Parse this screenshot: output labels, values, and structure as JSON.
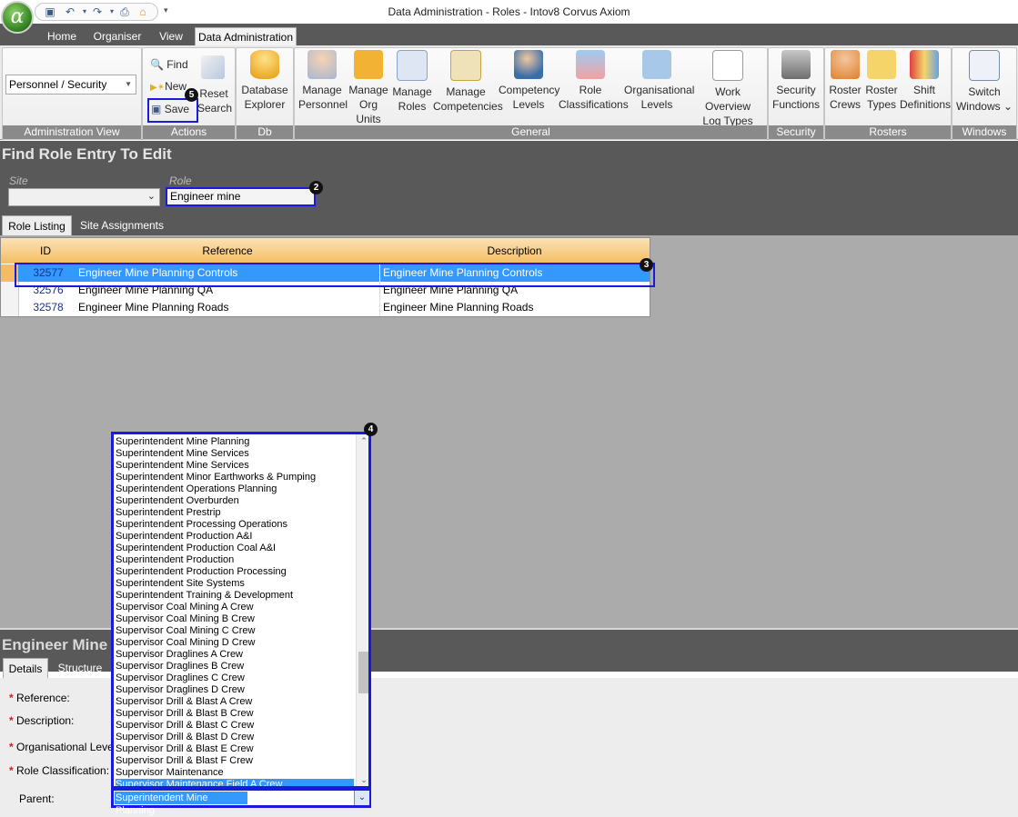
{
  "window": {
    "title": "Data Administration - Roles - Intov8 Corvus Axiom",
    "logo_letter": "α"
  },
  "menu_tabs": [
    "Home",
    "Organiser",
    "View",
    "Data Administration"
  ],
  "ribbon": {
    "admin_view": {
      "selected": "Personnel / Security",
      "caption": "Administration View"
    },
    "actions": {
      "find": "Find",
      "new": "New",
      "save": "Save",
      "reset": "Reset",
      "search": "Search",
      "caption": "Actions"
    },
    "db_explorer": {
      "label_line1": "Database",
      "label_line2": "Explorer",
      "caption": "Db Explorer"
    },
    "general": {
      "caption": "General",
      "buttons": [
        {
          "l1": "Manage",
          "l2": "Personnel",
          "icon": "person-info-icon"
        },
        {
          "l1": "Manage",
          "l2": "Org Units",
          "icon": "org-units-icon"
        },
        {
          "l1": "Manage",
          "l2": "Roles",
          "icon": "roles-card-icon"
        },
        {
          "l1": "Manage",
          "l2": "Competencies",
          "icon": "certificate-icon"
        },
        {
          "l1": "Competency",
          "l2": "Levels",
          "icon": "person-check-icon"
        },
        {
          "l1": "Role",
          "l2": "Classifications",
          "icon": "role-classifications-icon"
        },
        {
          "l1": "Organisational",
          "l2": "Levels",
          "icon": "hierarchy-icon"
        },
        {
          "l1": "Work Overview",
          "l2": "Log Types",
          "icon": "document-icon"
        }
      ]
    },
    "security": {
      "l1": "Security",
      "l2": "Functions",
      "caption": "Security"
    },
    "rosters": {
      "caption": "Rosters",
      "buttons": [
        {
          "l1": "Roster",
          "l2": "Crews"
        },
        {
          "l1": "Roster",
          "l2": "Types"
        },
        {
          "l1": "Shift",
          "l2": "Definitions"
        }
      ]
    },
    "windows": {
      "l1": "Switch",
      "l2": "Windows ⌄",
      "caption": "Windows"
    }
  },
  "find": {
    "title": "Find Role Entry To Edit",
    "site_label": "Site",
    "site_value": "",
    "role_label": "Role",
    "role_value": "Engineer mine"
  },
  "listing_tabs": [
    "Role Listing",
    "Site Assignments"
  ],
  "grid": {
    "headers": [
      "ID",
      "Reference",
      "Description"
    ],
    "rows": [
      {
        "id": "32577",
        "reference": "Engineer Mine Planning Controls",
        "description": "Engineer Mine Planning Controls"
      },
      {
        "id": "32576",
        "reference": "Engineer Mine Planning QA",
        "description": "Engineer Mine Planning QA"
      },
      {
        "id": "32578",
        "reference": "Engineer Mine Planning Roads",
        "description": "Engineer Mine Planning Roads"
      }
    ]
  },
  "detail": {
    "title": "Engineer Mine",
    "tabs": [
      "Details",
      "Structure"
    ],
    "fields": {
      "reference": "Reference:",
      "description": "Description:",
      "org_level": "Organisational Level:",
      "role_classification": "Role Classification:",
      "parent": "Parent:"
    },
    "parent_value": "Superintendent Mine Planning"
  },
  "dropdown": {
    "items": [
      "Superintendent Mine Planning",
      "Superintendent Mine Services",
      "Superintendent Mine Services",
      "Superintendent Minor Earthworks & Pumping",
      "Superintendent Operations Planning",
      "Superintendent Overburden",
      "Superintendent Prestrip",
      "Superintendent Processing Operations",
      "Superintendent Production A&I",
      "Superintendent Production Coal A&I",
      "Superintendent Production",
      "Superintendent Production Processing",
      "Superintendent Site Systems",
      "Superintendent Training & Development",
      "Supervisor Coal Mining A Crew",
      "Supervisor Coal Mining B Crew",
      "Supervisor Coal Mining C Crew",
      "Supervisor Coal Mining D Crew",
      "Supervisor Draglines A Crew",
      "Supervisor Draglines B Crew",
      "Supervisor Draglines C Crew",
      "Supervisor Draglines D Crew",
      "Supervisor Drill & Blast A Crew",
      "Supervisor Drill & Blast B Crew",
      "Supervisor Drill & Blast C Crew",
      "Supervisor Drill & Blast D Crew",
      "Supervisor Drill & Blast E Crew",
      "Supervisor Drill & Blast F Crew",
      "Supervisor Maintenance",
      "Supervisor Maintenance Field A Crew"
    ],
    "selected_index": 29,
    "scroll_position": 0.72
  },
  "callouts": [
    "2",
    "3",
    "4",
    "5"
  ],
  "colors": {
    "highlight": "#1a1adf",
    "grid_header": "#f4bd62",
    "selection": "#3399ff"
  }
}
